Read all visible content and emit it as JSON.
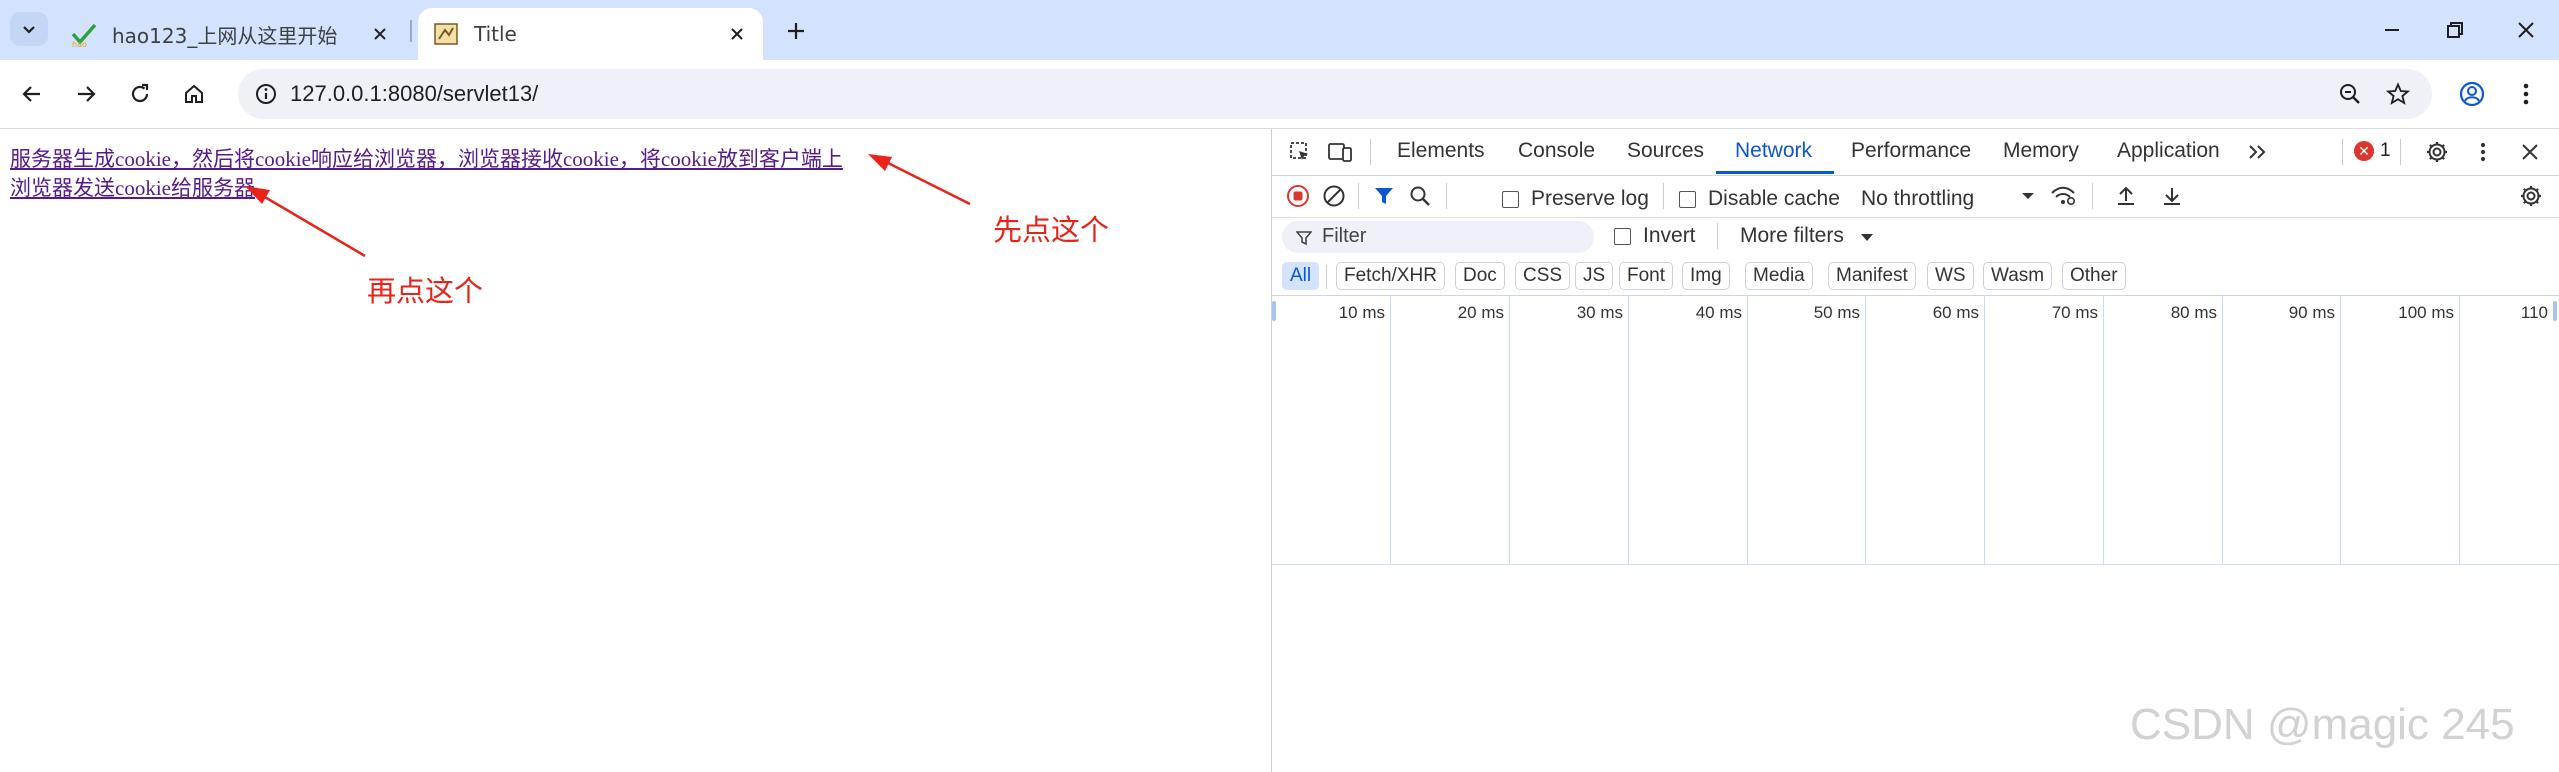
{
  "browser": {
    "tabs": [
      {
        "title": "hao123_上网从这里开始",
        "favicon": "hao123-icon",
        "active": false
      },
      {
        "title": "Title",
        "favicon": "page-favicon-icon",
        "active": true
      }
    ],
    "url": "127.0.0.1:8080/servlet13/"
  },
  "page": {
    "links": [
      "服务器生成cookie，然后将cookie响应给浏览器，浏览器接收cookie，将cookie放到客户端上",
      "浏览器发送cookie给服务器"
    ],
    "annotations": {
      "first": "先点这个",
      "second": "再点这个"
    }
  },
  "devtools": {
    "tabs": [
      "Elements",
      "Console",
      "Sources",
      "Network",
      "Performance",
      "Memory",
      "Application"
    ],
    "selected_tab": "Network",
    "error_count": "1",
    "preserve_log": "Preserve log",
    "disable_cache": "Disable cache",
    "throttling": "No throttling",
    "filter_placeholder": "Filter",
    "invert": "Invert",
    "more_filters": "More filters",
    "type_filters": [
      "All",
      "Fetch/XHR",
      "Doc",
      "CSS",
      "JS",
      "Font",
      "Img",
      "Media",
      "Manifest",
      "WS",
      "Wasm",
      "Other"
    ],
    "timeline_ticks": [
      "10 ms",
      "20 ms",
      "30 ms",
      "40 ms",
      "50 ms",
      "60 ms",
      "70 ms",
      "80 ms",
      "90 ms",
      "100 ms",
      "110"
    ]
  },
  "watermark": "CSDN @magic 245",
  "colors": {
    "tabstrip": "#d3e3fd",
    "link_visited": "#551a8b",
    "annotation": "#e8231a",
    "devtools_accent": "#0b57d0",
    "record_button": "#dc362e"
  }
}
